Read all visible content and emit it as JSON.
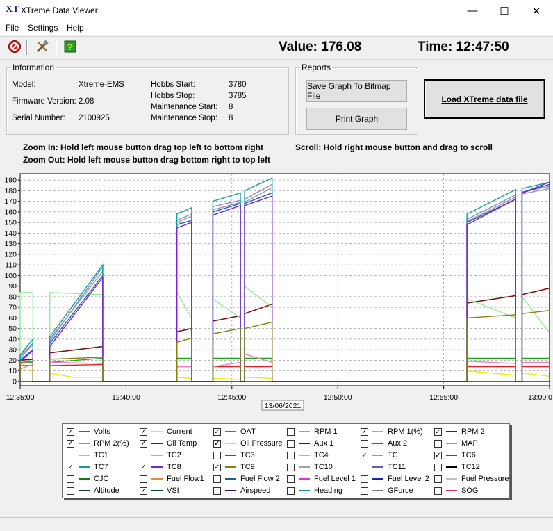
{
  "window": {
    "logo": "XT",
    "title": "XTreme Data Viewer",
    "min_glyph": "—",
    "max_glyph": "☐",
    "close_glyph": "✕"
  },
  "menu": {
    "file": "File",
    "settings": "Settings",
    "help": "Help"
  },
  "toolbar": {
    "icons": [
      "stop-icon",
      "tools-icon",
      "help-icon"
    ]
  },
  "readout": {
    "value": "Value: 176.08",
    "time": "Time: 12:47:50"
  },
  "information": {
    "legend": "Information",
    "model_label": "Model:",
    "model": "Xtreme-EMS",
    "firmware_label": "Firmware Version:",
    "firmware": "2.08",
    "serial_label": "Serial Number:",
    "serial": "2100925",
    "hobbs_start_label": "Hobbs Start:",
    "hobbs_start": "3780",
    "hobbs_stop_label": "Hobbs Stop:",
    "hobbs_stop": "3785",
    "maint_start_label": "Maintenance Start:",
    "maint_start": "8",
    "maint_stop_label": "Maintenance Stop:",
    "maint_stop": "8"
  },
  "reports": {
    "legend": "Reports",
    "save_button": "Save Graph To Bitmap File",
    "print_button": "Print Graph"
  },
  "load_button": "Load XTreme data file",
  "hints": {
    "zoom_in": "Zoom In: Hold left mouse button drag top left to bottom right",
    "zoom_out": "Zoom Out: Hold left mouse button drag bottom right to top left",
    "scroll": "Scroll: Hold right mouse button and drag to scroll"
  },
  "chart_data": {
    "type": "line",
    "x_tick_labels": [
      "12:35:00",
      "12:40:00",
      "12:45:00",
      "12:50:00",
      "12:55:00",
      "13:00:0"
    ],
    "x_range_minutes": [
      0,
      25
    ],
    "date_label": "13/06/2021",
    "y_ticks": [
      0,
      10,
      20,
      30,
      40,
      50,
      60,
      70,
      80,
      90,
      100,
      110,
      120,
      130,
      140,
      150,
      160,
      170,
      180,
      190
    ],
    "ylim": [
      -4,
      196
    ],
    "grid": true,
    "segments": [
      [
        0.0,
        0.6
      ],
      [
        1.4,
        3.9
      ],
      [
        7.4,
        8.1
      ],
      [
        9.1,
        10.4
      ],
      [
        10.6,
        11.9
      ],
      [
        21.1,
        23.4
      ],
      [
        23.7,
        25.0
      ]
    ],
    "series": [
      {
        "name": "Volts",
        "color": "#e0202a",
        "values": [
          [
            0.0,
            15
          ],
          [
            0.6,
            15
          ],
          [
            1.4,
            15
          ],
          [
            3.9,
            16
          ],
          [
            7.4,
            14
          ],
          [
            8.1,
            14
          ],
          [
            9.1,
            14
          ],
          [
            10.4,
            14
          ],
          [
            10.6,
            14
          ],
          [
            11.9,
            14
          ],
          [
            21.1,
            14
          ],
          [
            23.4,
            14
          ],
          [
            23.7,
            14
          ],
          [
            25.0,
            14
          ]
        ]
      },
      {
        "name": "Current",
        "color": "#f2e800",
        "values": [
          [
            0.0,
            12
          ],
          [
            0.6,
            10
          ],
          [
            1.4,
            8
          ],
          [
            2.5,
            4
          ],
          [
            3.9,
            4
          ],
          [
            7.4,
            4
          ],
          [
            8.1,
            3
          ],
          [
            9.1,
            3
          ],
          [
            10.4,
            2
          ],
          [
            10.6,
            4
          ],
          [
            11.9,
            3
          ],
          [
            21.1,
            10
          ],
          [
            23.4,
            6
          ],
          [
            23.7,
            8
          ],
          [
            25.0,
            5
          ]
        ]
      },
      {
        "name": "OAT",
        "color": "#22a020",
        "values": [
          [
            0.0,
            17
          ],
          [
            0.6,
            18
          ],
          [
            1.4,
            18
          ],
          [
            3.9,
            22
          ],
          [
            7.4,
            22
          ],
          [
            8.1,
            22
          ],
          [
            9.1,
            22
          ],
          [
            10.4,
            22
          ],
          [
            10.6,
            22
          ],
          [
            11.9,
            22
          ],
          [
            21.1,
            22
          ],
          [
            23.4,
            22
          ],
          [
            23.7,
            22
          ],
          [
            25.0,
            22
          ]
        ]
      },
      {
        "name": "RPM 1(%)",
        "color": "#f080c0",
        "values": [
          [
            0.0,
            12
          ],
          [
            0.6,
            16
          ],
          [
            1.4,
            18
          ],
          [
            3.9,
            17
          ],
          [
            7.4,
            14
          ],
          [
            8.1,
            14
          ],
          [
            9.1,
            14
          ],
          [
            10.4,
            18
          ],
          [
            10.6,
            26
          ],
          [
            11.9,
            18
          ],
          [
            21.1,
            19
          ],
          [
            23.4,
            17
          ],
          [
            23.7,
            18
          ],
          [
            25.0,
            18
          ]
        ]
      },
      {
        "name": "RPM 2",
        "color": "#7a1010",
        "values": [
          [
            0.0,
            20
          ],
          [
            0.6,
            21
          ],
          [
            1.4,
            27
          ],
          [
            3.9,
            33
          ],
          [
            7.4,
            47
          ],
          [
            8.1,
            50
          ],
          [
            9.1,
            57
          ],
          [
            10.4,
            62
          ],
          [
            10.6,
            64
          ],
          [
            11.9,
            73
          ],
          [
            21.1,
            74
          ],
          [
            23.4,
            81
          ],
          [
            23.7,
            82
          ],
          [
            25.0,
            88
          ]
        ]
      },
      {
        "name": "RPM 2(%)",
        "color": "#8a8ae0",
        "values": [
          [
            0.0,
            22
          ],
          [
            0.6,
            35
          ],
          [
            1.4,
            38
          ],
          [
            3.9,
            108
          ],
          [
            7.4,
            152
          ],
          [
            8.1,
            158
          ],
          [
            9.1,
            165
          ],
          [
            10.4,
            171
          ],
          [
            10.6,
            172
          ],
          [
            11.9,
            186
          ],
          [
            21.1,
            153
          ],
          [
            23.4,
            176
          ],
          [
            23.7,
            179
          ],
          [
            25.0,
            184
          ]
        ]
      },
      {
        "name": "Oil Temp",
        "color": "#7a1010",
        "values": [
          [
            0.0,
            20
          ],
          [
            0.6,
            21
          ],
          [
            1.4,
            27
          ],
          [
            3.9,
            33
          ],
          [
            7.4,
            47
          ],
          [
            8.1,
            50
          ],
          [
            9.1,
            57
          ],
          [
            10.4,
            62
          ],
          [
            10.6,
            64
          ],
          [
            11.9,
            73
          ],
          [
            21.1,
            74
          ],
          [
            23.4,
            81
          ],
          [
            23.7,
            82
          ],
          [
            25.0,
            88
          ]
        ]
      },
      {
        "name": "Oil Pressure",
        "color": "#90f090",
        "values": [
          [
            0.0,
            84
          ],
          [
            0.6,
            84
          ],
          [
            1.4,
            84
          ],
          [
            3.9,
            82
          ],
          [
            7.4,
            84
          ],
          [
            8.1,
            60
          ],
          [
            9.1,
            78
          ],
          [
            10.4,
            60
          ],
          [
            10.6,
            90
          ],
          [
            11.9,
            70
          ],
          [
            21.1,
            78
          ],
          [
            23.4,
            60
          ],
          [
            23.7,
            80
          ],
          [
            25.0,
            46
          ]
        ]
      },
      {
        "name": "TC",
        "color": "#9a9a9a",
        "values": [
          [
            0.0,
            24
          ],
          [
            0.6,
            36
          ],
          [
            1.4,
            40
          ],
          [
            3.9,
            104
          ],
          [
            7.4,
            150
          ],
          [
            8.1,
            156
          ],
          [
            9.1,
            162
          ],
          [
            10.4,
            169
          ],
          [
            10.6,
            169
          ],
          [
            11.9,
            183
          ],
          [
            21.1,
            151
          ],
          [
            23.4,
            174
          ],
          [
            23.7,
            177
          ],
          [
            25.0,
            182
          ]
        ]
      },
      {
        "name": "TC6",
        "color": "#1060b0",
        "values": [
          [
            0.0,
            20
          ],
          [
            0.6,
            30
          ],
          [
            1.4,
            36
          ],
          [
            3.9,
            100
          ],
          [
            7.4,
            148
          ],
          [
            8.1,
            152
          ],
          [
            9.1,
            160
          ],
          [
            10.4,
            168
          ],
          [
            10.6,
            168
          ],
          [
            11.9,
            178
          ],
          [
            21.1,
            150
          ],
          [
            23.4,
            172
          ],
          [
            23.7,
            178
          ],
          [
            25.0,
            186
          ]
        ]
      },
      {
        "name": "TC7",
        "color": "#10a0a0",
        "values": [
          [
            0.0,
            25
          ],
          [
            0.6,
            40
          ],
          [
            1.4,
            42
          ],
          [
            3.9,
            110
          ],
          [
            7.4,
            158
          ],
          [
            8.1,
            164
          ],
          [
            9.1,
            170
          ],
          [
            10.4,
            178
          ],
          [
            10.6,
            180
          ],
          [
            11.9,
            192
          ],
          [
            21.1,
            158
          ],
          [
            23.4,
            181
          ],
          [
            23.7,
            182
          ],
          [
            25.0,
            188
          ]
        ]
      },
      {
        "name": "TC8",
        "color": "#8020d0",
        "values": [
          [
            0.0,
            19
          ],
          [
            0.6,
            29
          ],
          [
            1.4,
            33
          ],
          [
            3.9,
            98
          ],
          [
            7.4,
            145
          ],
          [
            8.1,
            150
          ],
          [
            9.1,
            157
          ],
          [
            10.4,
            166
          ],
          [
            10.6,
            166
          ],
          [
            11.9,
            175
          ],
          [
            21.1,
            148
          ],
          [
            23.4,
            172
          ],
          [
            23.7,
            178
          ],
          [
            25.0,
            188
          ]
        ]
      },
      {
        "name": "TC9",
        "color": "#8a8010",
        "values": [
          [
            0.0,
            18
          ],
          [
            0.6,
            19
          ],
          [
            1.4,
            21
          ],
          [
            3.9,
            23
          ],
          [
            7.4,
            37
          ],
          [
            8.1,
            41
          ],
          [
            9.1,
            45
          ],
          [
            10.4,
            50
          ],
          [
            10.6,
            50
          ],
          [
            11.9,
            56
          ],
          [
            21.1,
            60
          ],
          [
            23.4,
            63
          ],
          [
            23.7,
            64
          ],
          [
            25.0,
            67
          ]
        ]
      },
      {
        "name": "VSI",
        "color": "#004040",
        "values": [
          [
            0.0,
            0
          ],
          [
            25.0,
            0
          ]
        ]
      }
    ]
  },
  "legend_items": [
    {
      "label": "Volts",
      "checked": true,
      "color": "#e0202a"
    },
    {
      "label": "Current",
      "checked": true,
      "color": "#f2e800"
    },
    {
      "label": "OAT",
      "checked": true,
      "color": "#22a020"
    },
    {
      "label": "RPM 1",
      "checked": false,
      "color": "#f08080"
    },
    {
      "label": "RPM 1(%)",
      "checked": true,
      "color": "#f080c0"
    },
    {
      "label": "RPM 2",
      "checked": true,
      "color": "#7a1010"
    },
    {
      "label": "RPM 2(%)",
      "checked": true,
      "color": "#8a8ae0"
    },
    {
      "label": "Oil Temp",
      "checked": true,
      "color": "#7a1010"
    },
    {
      "label": "Oil Pressure",
      "checked": true,
      "color": "#90f090"
    },
    {
      "label": "Aux 1",
      "checked": false,
      "color": "#202080"
    },
    {
      "label": "Aux 2",
      "checked": false,
      "color": "#805010"
    },
    {
      "label": "MAP",
      "checked": false,
      "color": "#f08030"
    },
    {
      "label": "TC1",
      "checked": false,
      "color": "#f090d0"
    },
    {
      "label": "TC2",
      "checked": false,
      "color": "#f090a0"
    },
    {
      "label": "TC3",
      "checked": false,
      "color": "#1060b0"
    },
    {
      "label": "TC4",
      "checked": false,
      "color": "#60d0f0"
    },
    {
      "label": "TC",
      "checked": true,
      "color": "#9a9a9a"
    },
    {
      "label": "TC6",
      "checked": true,
      "color": "#1060b0"
    },
    {
      "label": "TC7",
      "checked": true,
      "color": "#10a0a0"
    },
    {
      "label": "TC8",
      "checked": true,
      "color": "#8020d0"
    },
    {
      "label": "TC9",
      "checked": true,
      "color": "#8a8010"
    },
    {
      "label": "TC10",
      "checked": false,
      "color": "#a0a0a0"
    },
    {
      "label": "TC11",
      "checked": false,
      "color": "#6060c0"
    },
    {
      "label": "TC12",
      "checked": false,
      "color": "#000000"
    },
    {
      "label": "CJC",
      "checked": false,
      "color": "#108010"
    },
    {
      "label": "Fuel Flow1",
      "checked": false,
      "color": "#e09030"
    },
    {
      "label": "Fuel Flow 2",
      "checked": false,
      "color": "#206080"
    },
    {
      "label": "Fuel Level 1",
      "checked": false,
      "color": "#e030e0"
    },
    {
      "label": "Fuel Level 2",
      "checked": false,
      "color": "#2020a0"
    },
    {
      "label": "Fuel Pressure",
      "checked": false,
      "color": "#c0c0c0"
    },
    {
      "label": "Altitude",
      "checked": false,
      "color": "#104050"
    },
    {
      "label": "VSI",
      "checked": true,
      "color": "#004040"
    },
    {
      "label": "Airspeed",
      "checked": false,
      "color": "#401060"
    },
    {
      "label": "Heading",
      "checked": false,
      "color": "#2080c0"
    },
    {
      "label": "GForce",
      "checked": false,
      "color": "#808080"
    },
    {
      "label": "SOG",
      "checked": false,
      "color": "#e03070"
    }
  ]
}
